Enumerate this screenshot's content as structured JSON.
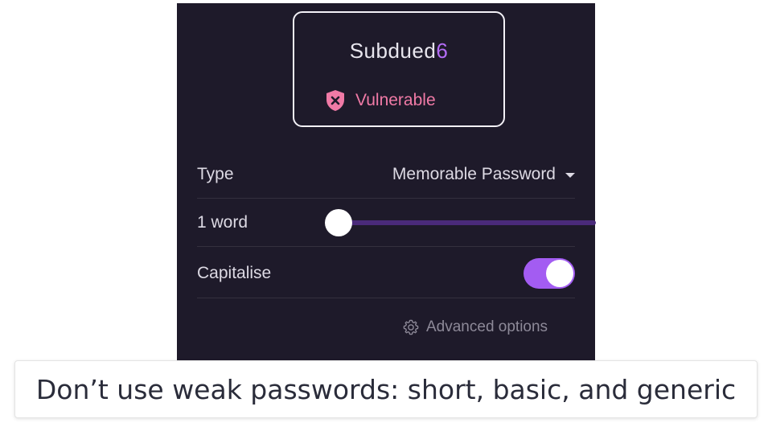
{
  "password": {
    "base": "Subdued",
    "digit": "6"
  },
  "strength": {
    "label": "Vulnerable",
    "icon": "shield-x-icon",
    "color": "#f07aa6"
  },
  "settings": {
    "type": {
      "label": "Type",
      "value": "Memorable Password"
    },
    "words": {
      "label": "1 word",
      "slider_fraction": 0
    },
    "capitalise": {
      "label": "Capitalise",
      "enabled": true
    },
    "advanced_label": "Advanced options"
  },
  "caption": "Don’t use weak passwords: short, basic, and generic",
  "colors": {
    "panel_bg": "#1e1a2a",
    "accent": "#a35cf2",
    "slider_track": "#4a2a7a"
  }
}
